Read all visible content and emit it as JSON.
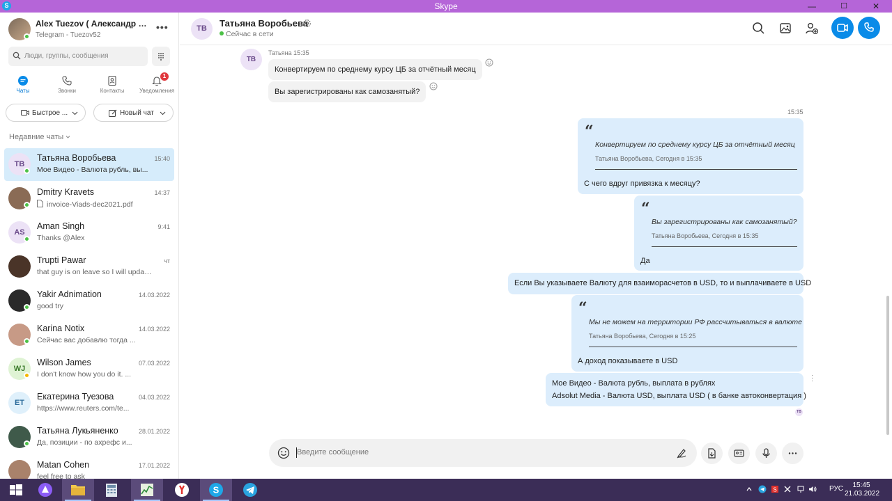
{
  "window": {
    "title": "Skype",
    "app_icon": "skype-logo",
    "controls": [
      "—",
      "☐",
      "✕"
    ]
  },
  "sidebar": {
    "me": {
      "name": "Alex Tuezov ( Александр Туе...",
      "subtitle": "Telegram - Tuezov52",
      "more": "•••"
    },
    "search_placeholder": "Люди, группы, сообщения",
    "nav": [
      {
        "label": "Чаты",
        "icon": "chat-icon"
      },
      {
        "label": "Звонки",
        "icon": "phone-icon"
      },
      {
        "label": "Контакты",
        "icon": "contacts-icon"
      },
      {
        "label": "Уведомления",
        "icon": "bell-icon",
        "badge": "1"
      }
    ],
    "quick_button": "Быстрое ...",
    "new_chat_button": "Новый чат",
    "recent_header": "Недавние чаты",
    "chats": [
      {
        "initials": "ТВ",
        "name": "Татьяна Воробьева",
        "time": "15:40",
        "preview": "Мое Видео - Валюта рубль, вы...",
        "status": "online",
        "avatar_color": "#ece2f6",
        "text_color": "#6a4a8a"
      },
      {
        "initials": "",
        "name": "Dmitry Kravets",
        "time": "14:37",
        "preview": "invoice-Viads-dec2021.pdf",
        "status": "online",
        "avatar_color": "#8a6b55",
        "text_color": "#fff",
        "file_icon": true
      },
      {
        "initials": "AS",
        "name": "Aman Singh",
        "time": "9:41",
        "preview": "Thanks @Alex",
        "status": "online",
        "avatar_color": "#ece2f6",
        "text_color": "#6a4a8a"
      },
      {
        "initials": "",
        "name": "Trupti Pawar",
        "time": "чт",
        "preview": "that guy is on leave so I will update...",
        "status": "none",
        "avatar_color": "#4a3428",
        "text_color": "#fff"
      },
      {
        "initials": "",
        "name": "Yakir Adnimation",
        "time": "14.03.2022",
        "preview": "good try",
        "status": "online",
        "avatar_color": "#2a2a2a",
        "text_color": "#fff"
      },
      {
        "initials": "",
        "name": "Karina Notix",
        "time": "14.03.2022",
        "preview": "Сейчас вас добавлю тогда ...",
        "status": "online",
        "avatar_color": "#c79a86",
        "text_color": "#fff"
      },
      {
        "initials": "WJ",
        "name": "Wilson James",
        "time": "07.03.2022",
        "preview": "I don't know how you do it. ...",
        "status": "away",
        "avatar_color": "#dff3d4",
        "text_color": "#3a7a2a"
      },
      {
        "initials": "ЕТ",
        "name": "Екатерина Туезова",
        "time": "04.03.2022",
        "preview": "https://www.reuters.com/te...",
        "status": "none",
        "avatar_color": "#dff0fb",
        "text_color": "#2a6a9a"
      },
      {
        "initials": "",
        "name": "Татьяна Лукьяненко",
        "time": "28.01.2022",
        "preview": "Да, позиции - по ахрефс и...",
        "status": "online",
        "avatar_color": "#3f5a4a",
        "text_color": "#fff"
      },
      {
        "initials": "",
        "name": "Matan Cohen",
        "time": "17.01.2022",
        "preview": "feel free to ask",
        "status": "none",
        "avatar_color": "#a9826b",
        "text_color": "#fff"
      }
    ]
  },
  "conversation": {
    "contact_initials": "ТВ",
    "contact_name": "Татьяна Воробьева",
    "contact_status": "Сейчас в сети",
    "incoming_meta": "Татьяна 15:35",
    "incoming": [
      "Конвертируем по среднему курсу ЦБ за отчётный месяц",
      "Вы зарегистрированы как самозанятый?"
    ],
    "outgoing_time": "15:35",
    "outgoing": [
      {
        "quote": "Конвертируем по среднему курсу ЦБ за отчётный месяц",
        "quote_meta": "Татьяна Воробьева, Сегодня в 15:35",
        "text": "С чего вдруг привязка к месяцу?"
      },
      {
        "quote": "Вы зарегистрированы как самозанятый?",
        "quote_meta": "Татьяна Воробьева, Сегодня в 15:35",
        "text": "Да"
      },
      {
        "text": "Если Вы указываете Валюту для взаиморасчетов в USD, то и выплачиваете в USD"
      },
      {
        "quote": "Мы не можем на территории РФ рассчитываться в валюте",
        "quote_meta": "Татьяна Воробьева, Сегодня в 15:25",
        "text": "А доход показываете в USD"
      },
      {
        "lines": [
          "Мое Видео - Валюта рубль, выплата в рублях",
          "Adsolut Media - Валюта USD, выплата USD ( в банке автоконвертация )"
        ]
      }
    ],
    "quote_mark": "“",
    "seen_initials": "ТВ",
    "composer_placeholder": "Введите сообщение"
  },
  "taskbar": {
    "tray_lang": "РУС",
    "time": "15:45",
    "date": "21.03.2022"
  },
  "colors": {
    "titlebar": "#b565d8",
    "accent": "#0a8be8",
    "online": "#4cc146",
    "away": "#f5b800",
    "bubble_in": "#f2f2f2",
    "bubble_out": "#dcedfc",
    "taskbar": "#3b2d57"
  }
}
